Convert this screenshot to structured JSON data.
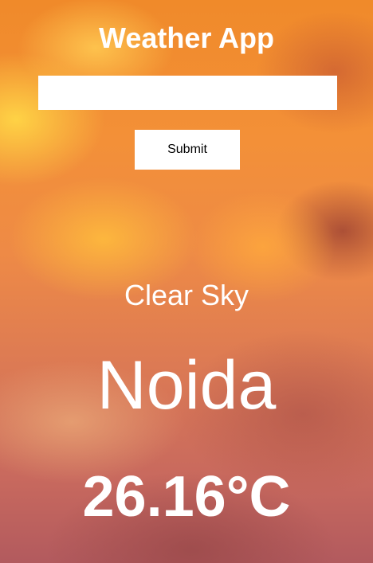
{
  "app": {
    "title": "Weather App"
  },
  "search": {
    "value": "",
    "placeholder": "",
    "submit_label": "Submit"
  },
  "weather": {
    "description": "Clear Sky",
    "city": "Noida",
    "temperature": "26.16°C"
  }
}
